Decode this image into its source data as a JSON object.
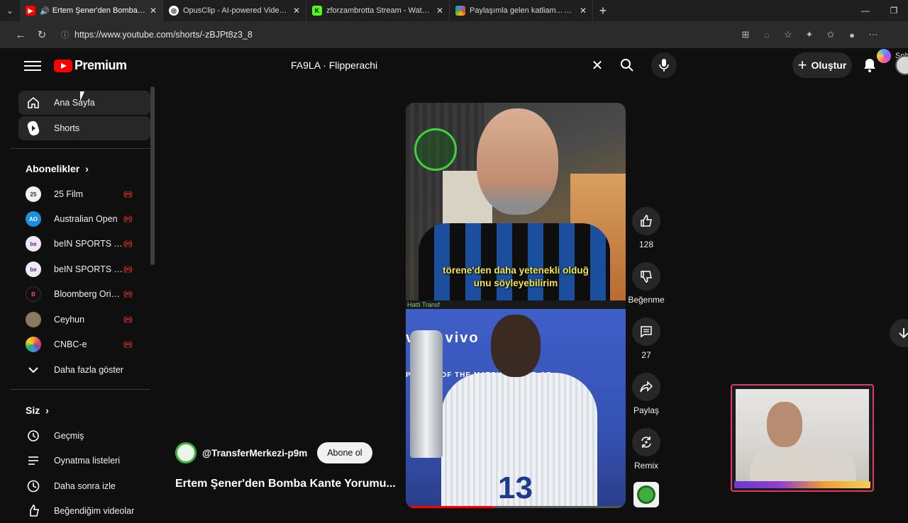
{
  "browser": {
    "tabs": [
      {
        "title": "Ertem Şener'den Bomba Kante",
        "favicon": "youtube-favicon",
        "active": true,
        "audio": true
      },
      {
        "title": "OpusClip - AI-powered Video Rep",
        "favicon": "opusclip-favicon",
        "active": false
      },
      {
        "title": "zforzambrotta Stream - Watch Live",
        "favicon": "kick-favicon",
        "active": false
      },
      {
        "title": "Paylaşımla gelen katliam... Ada ile",
        "favicon": "colorful-favicon",
        "active": false
      }
    ],
    "url": "https://www.youtube.com/shorts/-zBJPt8z3_8",
    "copilot_label": "Soh"
  },
  "header": {
    "logo_text": "Premium",
    "search_query": "FA9LA · Flipperachi",
    "create_label": "Oluştur"
  },
  "sidebar": {
    "primary": [
      {
        "label": "Ana Sayfa",
        "icon": "home-icon"
      },
      {
        "label": "Shorts",
        "icon": "shorts-icon"
      }
    ],
    "subscriptions_title": "Abonelikler",
    "channels": [
      {
        "label": "25 Film",
        "live": true
      },
      {
        "label": "Australian Open",
        "live": true
      },
      {
        "label": "beIN SPORTS Tü...",
        "live": true
      },
      {
        "label": "beIN SPORTS USA",
        "live": true
      },
      {
        "label": "Bloomberg Origi...",
        "live": true
      },
      {
        "label": "Ceyhun",
        "live": true
      },
      {
        "label": "CNBC-e",
        "live": true
      }
    ],
    "show_more": "Daha fazla göster",
    "you_title": "Siz",
    "you_items": [
      {
        "label": "Geçmiş",
        "icon": "history-icon"
      },
      {
        "label": "Oynatma listeleri",
        "icon": "playlist-icon"
      },
      {
        "label": "Daha sonra izle",
        "icon": "clock-icon"
      },
      {
        "label": "Beğendiğim videolar",
        "icon": "like-icon"
      }
    ]
  },
  "short": {
    "caption_line1": "törene'den daha yetenekli olduğ",
    "caption_line2": "unu söyleyebilirim",
    "top_tag": "Hatti Transf",
    "banner_text": "vivo  vivo",
    "banner_small": "PLAYER OF THE MATCH   PLAYER OF",
    "jersey_number": "13",
    "progress": 0.4,
    "channel_handle": "@TransferMerkezi-p9m",
    "subscribe_label": "Abone ol",
    "title": "Ertem Şener'den Bomba Kante Yorumu..."
  },
  "actions": {
    "like_count": "128",
    "dislike_label": "Beğenme",
    "comment_count": "27",
    "share_label": "Paylaş",
    "remix_label": "Remix"
  },
  "colors": {
    "brand_red": "#ff0000",
    "background": "#0f0f0f",
    "live_red": "#ff3030"
  }
}
